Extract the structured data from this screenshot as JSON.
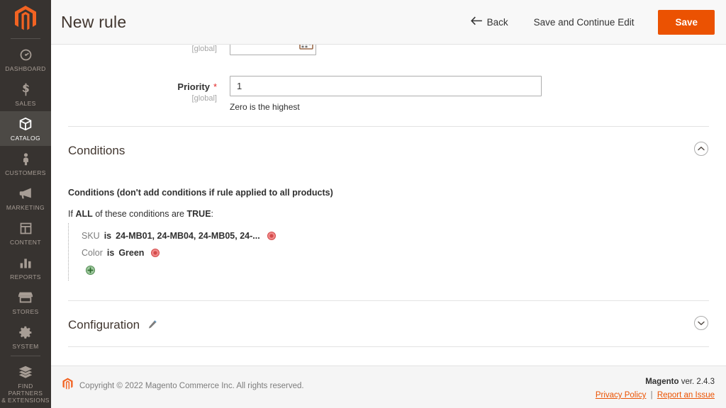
{
  "sidebar": {
    "logo": "magento-logo",
    "items": [
      {
        "label": "Dashboard",
        "icon": "gauge-icon",
        "active": false
      },
      {
        "label": "Sales",
        "icon": "dollar-icon",
        "active": false
      },
      {
        "label": "Catalog",
        "icon": "box-icon",
        "active": true
      },
      {
        "label": "Customers",
        "icon": "person-icon",
        "active": false
      },
      {
        "label": "Marketing",
        "icon": "megaphone-icon",
        "active": false
      },
      {
        "label": "Content",
        "icon": "layout-icon",
        "active": false
      },
      {
        "label": "Reports",
        "icon": "bars-icon",
        "active": false
      },
      {
        "label": "Stores",
        "icon": "storefront-icon",
        "active": false
      },
      {
        "label": "System",
        "icon": "gear-icon",
        "active": false
      },
      {
        "label": "Find Partners\n& Extensions",
        "icon": "bricks-icon",
        "active": false
      }
    ],
    "find_partners_line1": "Find Partners",
    "find_partners_line2": "& Extensions"
  },
  "header": {
    "title": "New rule",
    "back_label": "Back",
    "save_continue_label": "Save and Continue Edit",
    "save_label": "Save",
    "accent_color": "#eb5202"
  },
  "form": {
    "date_field": {
      "scope": "[global]",
      "value": ""
    },
    "priority": {
      "label": "Priority",
      "required": "*",
      "scope": "[global]",
      "value": "1",
      "note": "Zero is the highest"
    }
  },
  "conditions_section": {
    "title": "Conditions",
    "expanded": true,
    "chevron": "chevron-up-icon",
    "heading": "Conditions (don't add conditions if rule applied to all products)",
    "if_prefix": "If",
    "aggregator": "ALL",
    "if_middle": "of these conditions are",
    "value": "TRUE",
    "if_suffix": ":",
    "rows": [
      {
        "attribute": "SKU",
        "operator": "is",
        "value": "24-MB01, 24-MB04, 24-MB05, 24-...",
        "delete_icon": "delete-circle-icon"
      },
      {
        "attribute": "Color",
        "operator": "is",
        "value": "Green",
        "delete_icon": "delete-circle-icon"
      }
    ],
    "add_icon": "add-circle-icon"
  },
  "configuration_section": {
    "title": "Configuration",
    "edit_icon": "pencil-icon",
    "expanded": false,
    "chevron": "chevron-down-icon"
  },
  "footer": {
    "logo": "magento-logo",
    "copyright": "Copyright © 2022 Magento Commerce Inc. All rights reserved.",
    "brand": "Magento",
    "version": "ver. 2.4.3",
    "privacy_link": "Privacy Policy",
    "separator": "|",
    "report_link": "Report an Issue"
  }
}
